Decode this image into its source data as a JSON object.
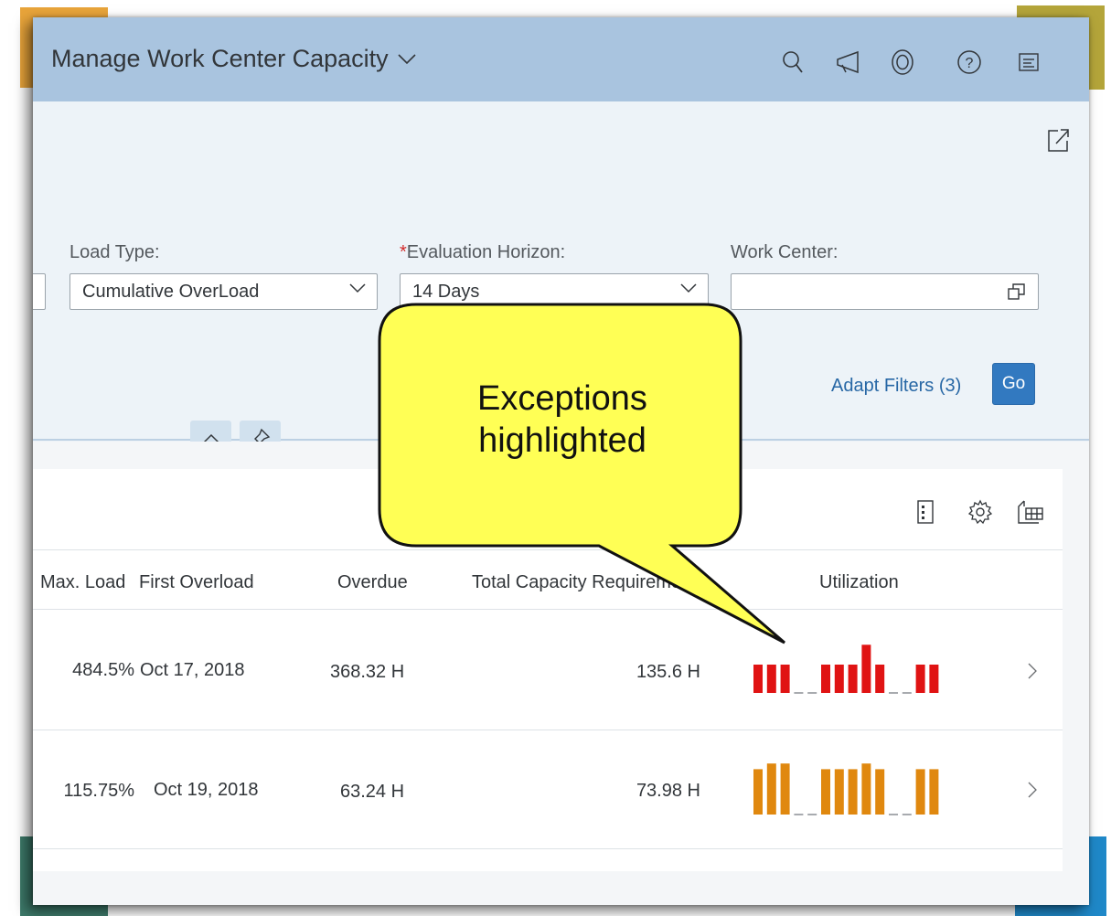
{
  "app": {
    "title": "Manage Work Center Capacity",
    "shell_icons": [
      "search-icon",
      "megaphone-icon",
      "copilot-icon",
      "help-icon",
      "menu-icon"
    ]
  },
  "filters": {
    "load_type": {
      "label": "Load Type:",
      "value": "Cumulative OverLoad"
    },
    "evaluation_horizon": {
      "required_mark": "*",
      "label": "Evaluation Horizon:",
      "value": "14 Days"
    },
    "work_center": {
      "label": "Work Center:",
      "value": ""
    },
    "adapt_filters_label": "Adapt Filters (3)",
    "go_label": "Go"
  },
  "table": {
    "columns": [
      "Max. Load",
      "First Overload",
      "Overdue",
      "Total Capacity Requirement",
      "Utilization"
    ],
    "rows": [
      {
        "max_load": "484.5%",
        "first_overload": "Oct 17, 2018",
        "overdue": "368.32 H",
        "total_capacity": "135.6 H",
        "utilization_color": "#e01313",
        "utilization": [
          0.5,
          0.5,
          0.5,
          0,
          0,
          0.5,
          0.5,
          0.5,
          0.85,
          0.5,
          0,
          0,
          0.5,
          0.5
        ]
      },
      {
        "max_load": "115.75%",
        "first_overload": "Oct 19, 2018",
        "overdue": "63.24 H",
        "total_capacity": "73.98 H",
        "utilization_color": "#e0880f",
        "utilization": [
          0.8,
          0.9,
          0.9,
          0,
          0,
          0.8,
          0.8,
          0.8,
          0.9,
          0.8,
          0,
          0,
          0.8,
          0.8
        ]
      }
    ]
  },
  "callout": {
    "line1": "Exceptions",
    "line2": "highlighted",
    "fill": "#ffff55"
  },
  "colors": {
    "shell": "#a9c4df",
    "accent": "#3279c0",
    "link": "#2767a5"
  }
}
